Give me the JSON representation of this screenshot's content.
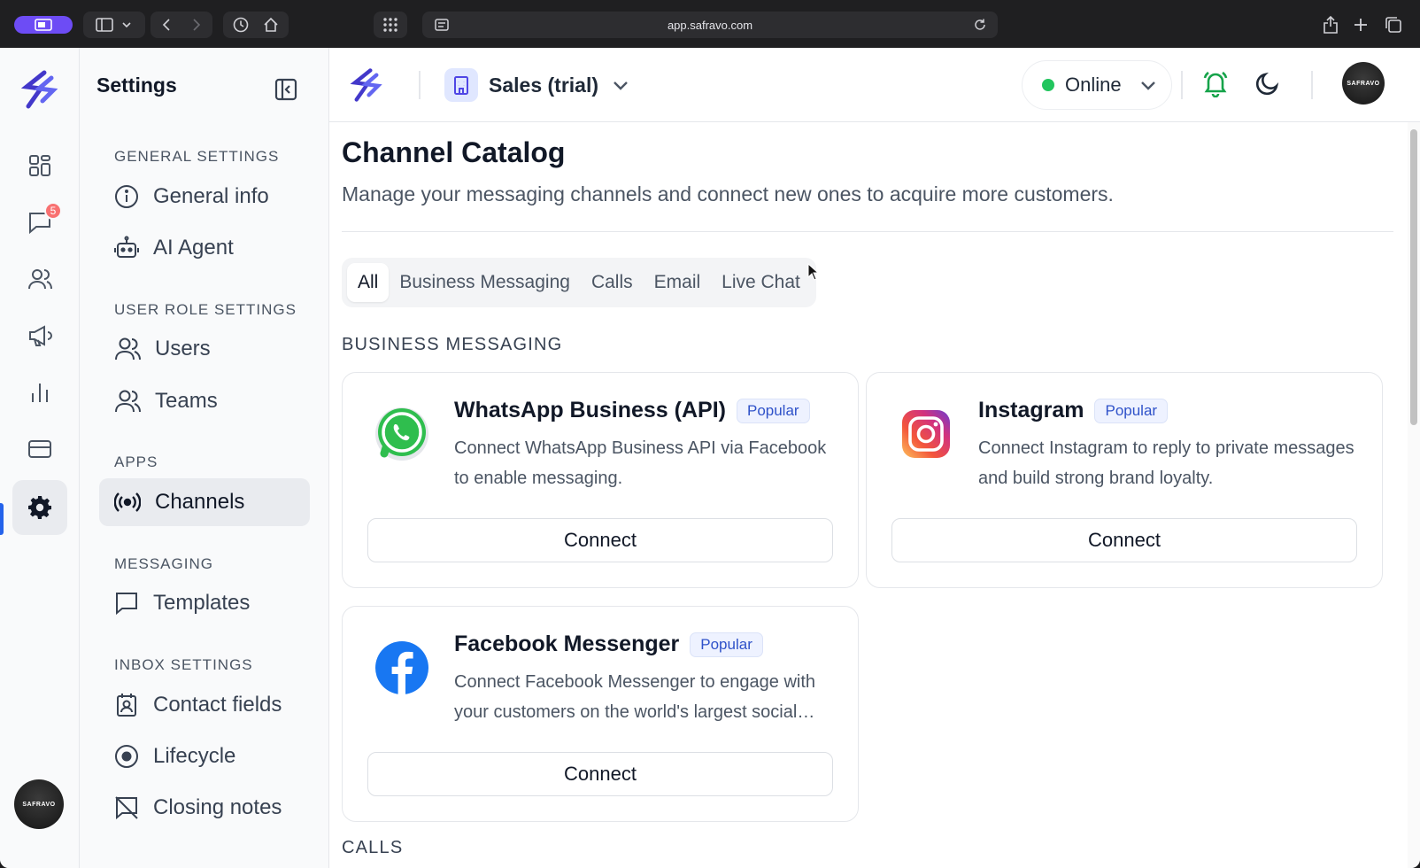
{
  "browser": {
    "url": "app.safravo.com"
  },
  "rail": {
    "inbox_badge": "5",
    "avatar_text": "SAFRAVO"
  },
  "settings": {
    "title": "Settings",
    "sections": {
      "general": "GENERAL SETTINGS",
      "user_role": "USER ROLE SETTINGS",
      "apps": "APPS",
      "messaging": "MESSAGING",
      "inbox": "INBOX SETTINGS"
    },
    "items": {
      "general_info": "General info",
      "ai_agent": "AI Agent",
      "users": "Users",
      "teams": "Teams",
      "channels": "Channels",
      "templates": "Templates",
      "contact_fields": "Contact fields",
      "lifecycle": "Lifecycle",
      "closing_notes": "Closing notes"
    }
  },
  "header": {
    "workspace": "Sales (trial)",
    "status": "Online",
    "status_color": "#22c55e",
    "avatar_text": "SAFRAVO"
  },
  "main": {
    "title": "Channel Catalog",
    "subtitle": "Manage your messaging channels and connect new ones to acquire more customers.",
    "tabs": [
      "All",
      "Business Messaging",
      "Calls",
      "Email",
      "Live Chat"
    ],
    "active_tab": "All",
    "group_business": "BUSINESS MESSAGING",
    "group_calls": "CALLS",
    "cards": [
      {
        "title": "WhatsApp Business (API)",
        "badge": "Popular",
        "desc": "Connect WhatsApp Business API via Facebook to enable messaging.",
        "button": "Connect",
        "icon": "whatsapp-logo"
      },
      {
        "title": "Instagram",
        "badge": "Popular",
        "desc": "Connect Instagram to reply to private messages and build strong brand loyalty.",
        "button": "Connect",
        "icon": "instagram-logo"
      },
      {
        "title": "Facebook Messenger",
        "badge": "Popular",
        "desc": "Connect Facebook Messenger to engage with your customers on the world's largest social network.",
        "button": "Connect",
        "icon": "facebook-logo"
      }
    ]
  },
  "colors": {
    "accent": "#2563eb",
    "badge": "#f87171",
    "popular_text": "#2f52c9"
  }
}
